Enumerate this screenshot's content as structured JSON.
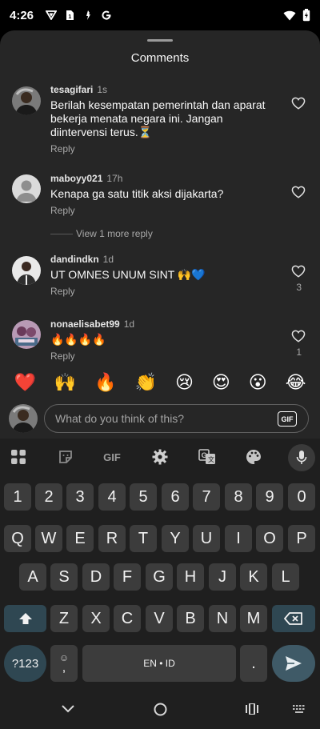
{
  "status_bar": {
    "time": "4:26",
    "left_icons": [
      "vpn-icon",
      "sim-icon",
      "shield-icon",
      "google-icon"
    ],
    "right_icons": [
      "wifi-icon",
      "battery-icon"
    ]
  },
  "sheet": {
    "title": "Comments",
    "comments": [
      {
        "user": "tesagifari",
        "time": "1s",
        "text": "Berilah kesempatan pemerintah dan aparat bekerja menata negara ini. Jangan diintervensi terus.⏳",
        "reply_label": "Reply",
        "likes": ""
      },
      {
        "user": "maboyy021",
        "time": "17h",
        "text": "Kenapa ga satu titik aksi dijakarta?",
        "reply_label": "Reply",
        "likes": ""
      },
      {
        "user": "dandindkn",
        "time": "1d",
        "text": "UT OMNES UNUM SINT 🙌💙",
        "reply_label": "Reply",
        "likes": "3"
      },
      {
        "user": "nonaelisabet99",
        "time": "1d",
        "text": "🔥🔥🔥🔥",
        "reply_label": "Reply",
        "likes": "1"
      }
    ],
    "view_more_replies": "View 1 more reply"
  },
  "emoji_bar": [
    "❤️",
    "🙌",
    "🔥",
    "👏",
    "😢",
    "😍",
    "😮",
    "😂"
  ],
  "comment_input": {
    "placeholder": "What do you think of this?",
    "gif_label": "GIF"
  },
  "keyboard": {
    "toolbar": {
      "gif_label": "GIF"
    },
    "rows": [
      [
        "1",
        "2",
        "3",
        "4",
        "5",
        "6",
        "7",
        "8",
        "9",
        "0"
      ],
      [
        "Q",
        "W",
        "E",
        "R",
        "T",
        "Y",
        "U",
        "I",
        "O",
        "P"
      ],
      [
        "A",
        "S",
        "D",
        "F",
        "G",
        "H",
        "J",
        "K",
        "L"
      ],
      [
        "Z",
        "X",
        "C",
        "V",
        "B",
        "N",
        "M"
      ]
    ],
    "symbols_label": "?123",
    "emoji_key_label": ",",
    "space_label": "EN • ID",
    "period_label": "."
  },
  "colors": {
    "sheet_bg": "#262626",
    "keyboard_bg": "#1f1f1f",
    "accent_key": "#2f4752",
    "like_red": "#ed4956"
  }
}
